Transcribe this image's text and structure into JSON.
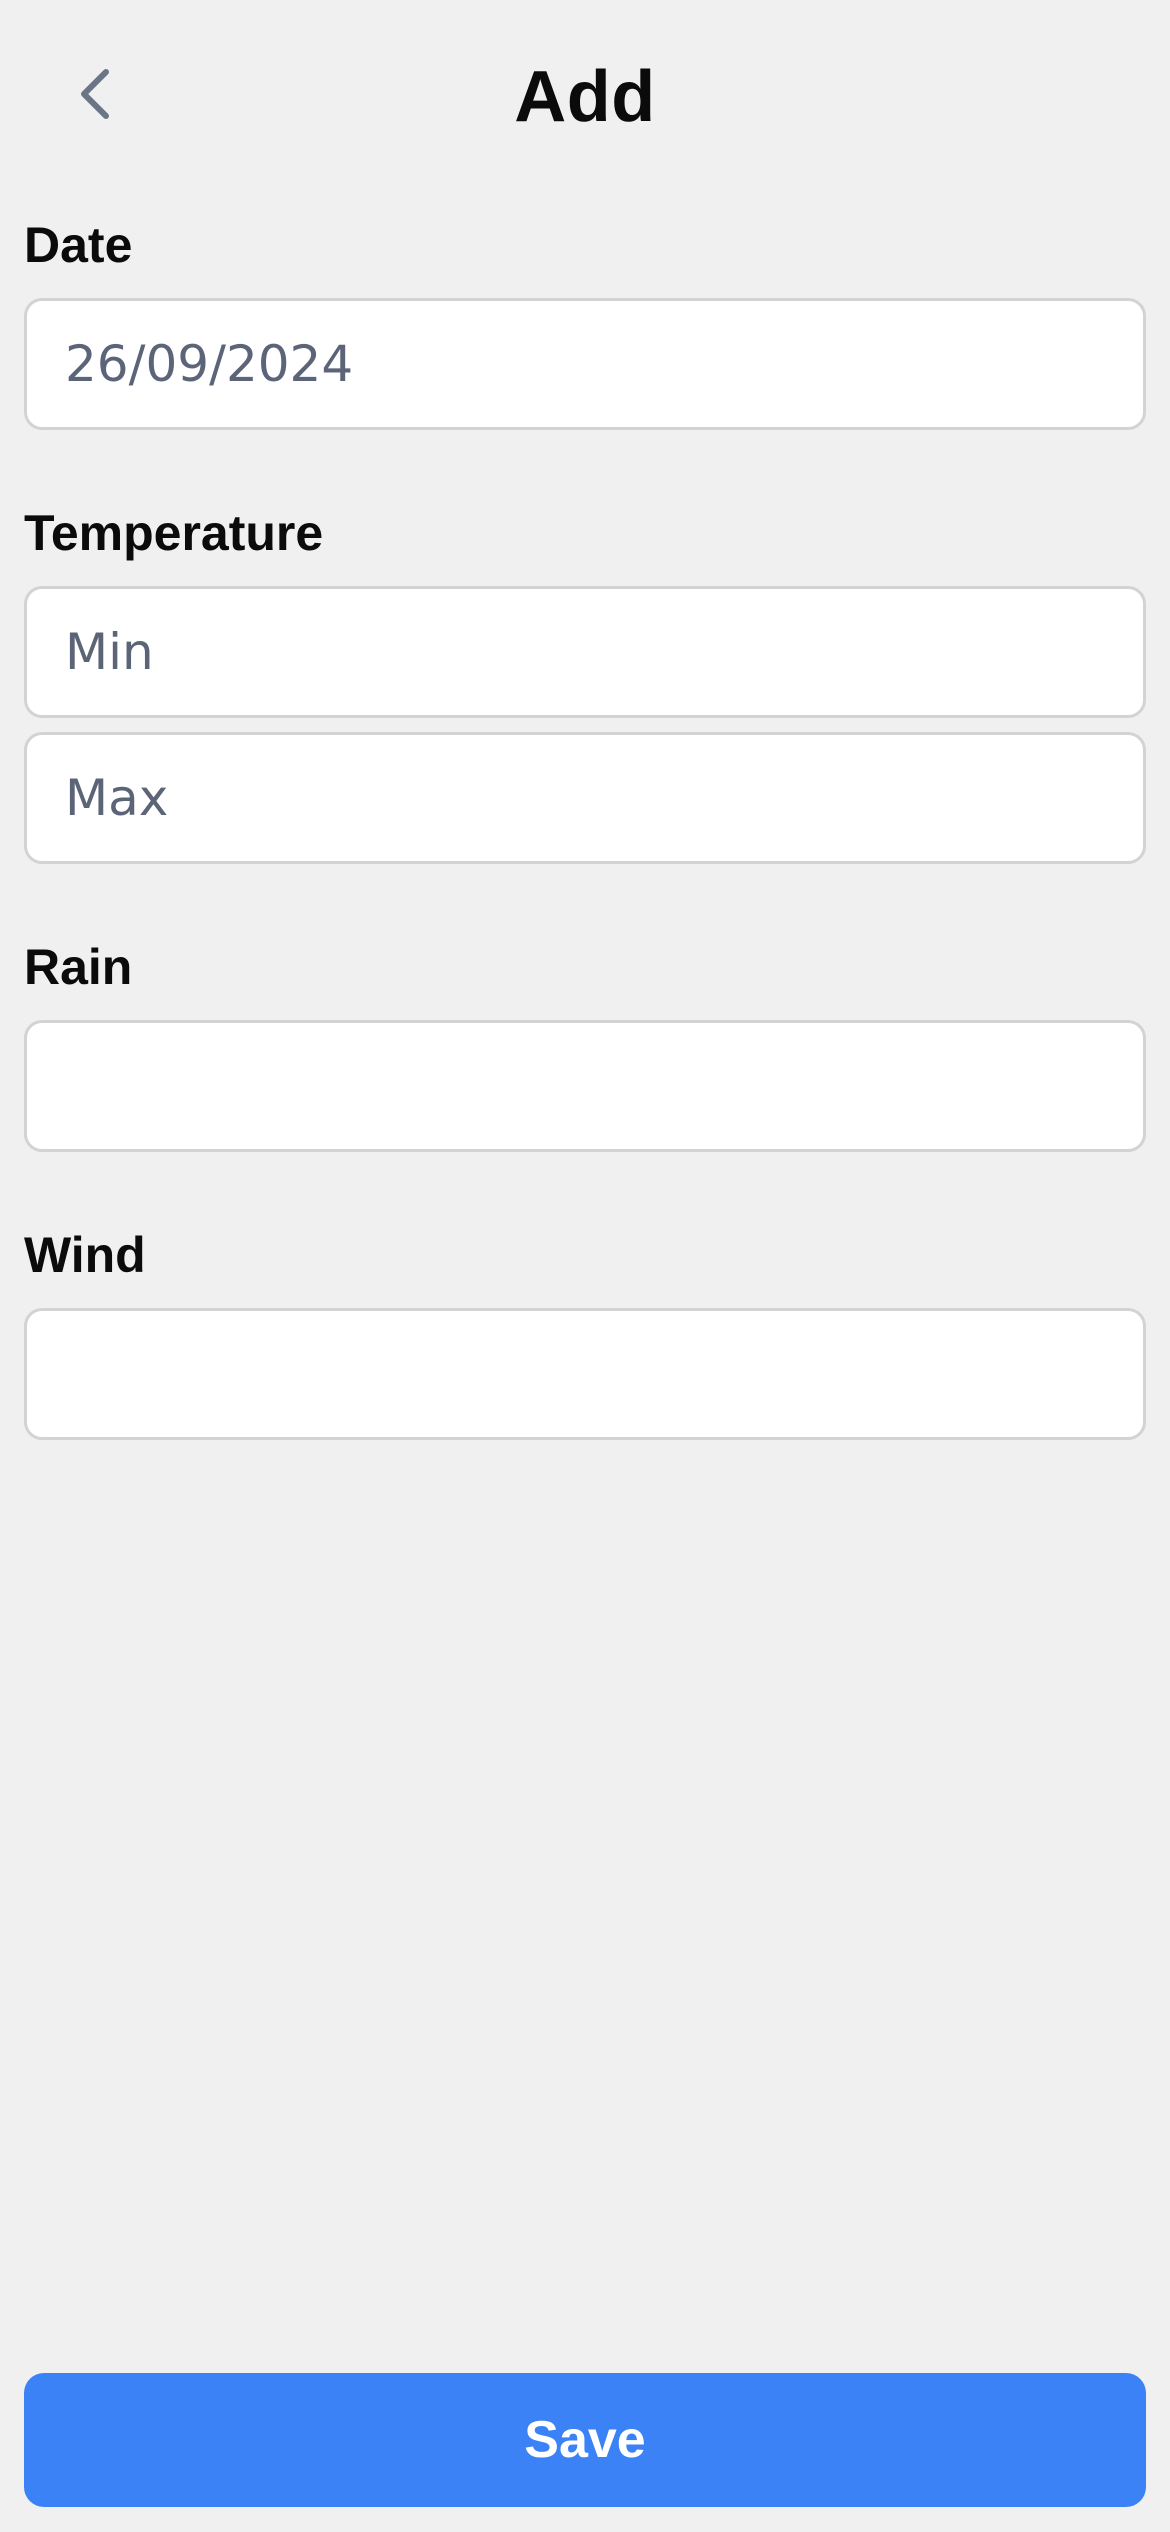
{
  "header": {
    "title": "Add",
    "back_icon": "chevron-left-icon"
  },
  "form": {
    "date": {
      "label": "Date",
      "value": "26/09/2024"
    },
    "temperature": {
      "label": "Temperature",
      "min_placeholder": "Min",
      "max_placeholder": "Max"
    },
    "rain": {
      "label": "Rain",
      "value": ""
    },
    "wind": {
      "label": "Wind",
      "value": ""
    }
  },
  "actions": {
    "save_label": "Save"
  },
  "colors": {
    "background": "#f0f0f0",
    "accent": "#3b82f6",
    "field_border": "#d3d3d6",
    "placeholder_text": "#5c6577"
  }
}
